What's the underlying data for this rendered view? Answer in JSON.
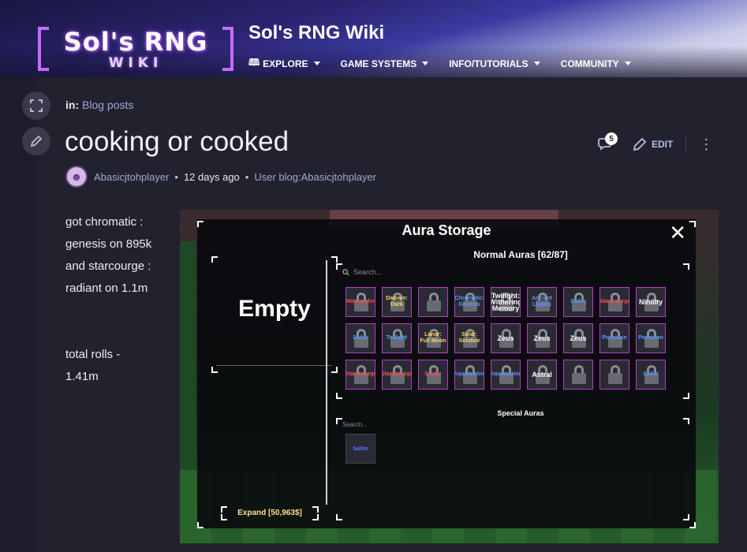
{
  "header": {
    "logo_main": "Sol's RNG",
    "logo_sub": "WIKI",
    "site_title": "Sol's RNG Wiki",
    "nav": [
      {
        "label": "EXPLORE"
      },
      {
        "label": "GAME SYSTEMS"
      },
      {
        "label": "INFO/TUTORIALS"
      },
      {
        "label": "COMMUNITY"
      }
    ]
  },
  "article": {
    "in_label": "in:",
    "in_link": "Blog posts",
    "title": "cooking or cooked",
    "comment_count": "5",
    "edit_label": "EDIT",
    "author": "Abasicjtohplayer",
    "time_ago": "12 days ago",
    "blog_link": "User blog:Abasicjtohplayer",
    "body": [
      "got chromatic :",
      "genesis on 895k",
      "and starcourge :",
      "radiant on 1.1m",
      "",
      "",
      "total rolls -",
      "1.41m"
    ]
  },
  "game": {
    "panel_title": "Aura Storage",
    "empty_label": "Empty",
    "normal_title": "Normal Auras [62/87]",
    "search_placeholder": "Search...",
    "special_title": "Special Auras",
    "special_search": "Search...",
    "special_tile": "Sailor",
    "expand_label": "Expand [50,963$]",
    "tiles": [
      {
        "name": "Watermelon",
        "style": "red"
      },
      {
        "name": "Damain: Dark",
        "style": "gold"
      },
      {
        "name": "",
        "style": "blue"
      },
      {
        "name": "Chromatic: Genesis",
        "style": "blue"
      },
      {
        "name": "Twilight: Withering Memory",
        "style": "white"
      },
      {
        "name": "Ancient Legacy",
        "style": "blue"
      },
      {
        "name": "Sailor",
        "style": "blue"
      },
      {
        "name": "Starscourge",
        "style": "red"
      },
      {
        "name": "Nihility",
        "style": "white"
      },
      {
        "name": "Sailor",
        "style": "blue"
      },
      {
        "name": "Twilight",
        "style": "blue"
      },
      {
        "name": "Lunar: Full Moon",
        "style": "gold"
      },
      {
        "name": "Solar: Solstice",
        "style": "gold"
      },
      {
        "name": "Zeus",
        "style": "white"
      },
      {
        "name": "Zeus",
        "style": "white"
      },
      {
        "name": "Zeus",
        "style": "white"
      },
      {
        "name": "Poseidon",
        "style": "blue"
      },
      {
        "name": "Poseidon",
        "style": "blue"
      },
      {
        "name": "Starscourge",
        "style": "red"
      },
      {
        "name": "Starscourge",
        "style": "red"
      },
      {
        "name": "Savior",
        "style": "red"
      },
      {
        "name": "Aquamarine",
        "style": "blue"
      },
      {
        "name": "Aquamarine",
        "style": "blue"
      },
      {
        "name": "Astral",
        "style": "white"
      },
      {
        "name": "",
        "style": "white"
      },
      {
        "name": "",
        "style": "white"
      },
      {
        "name": "Sailor",
        "style": "blue"
      }
    ]
  }
}
